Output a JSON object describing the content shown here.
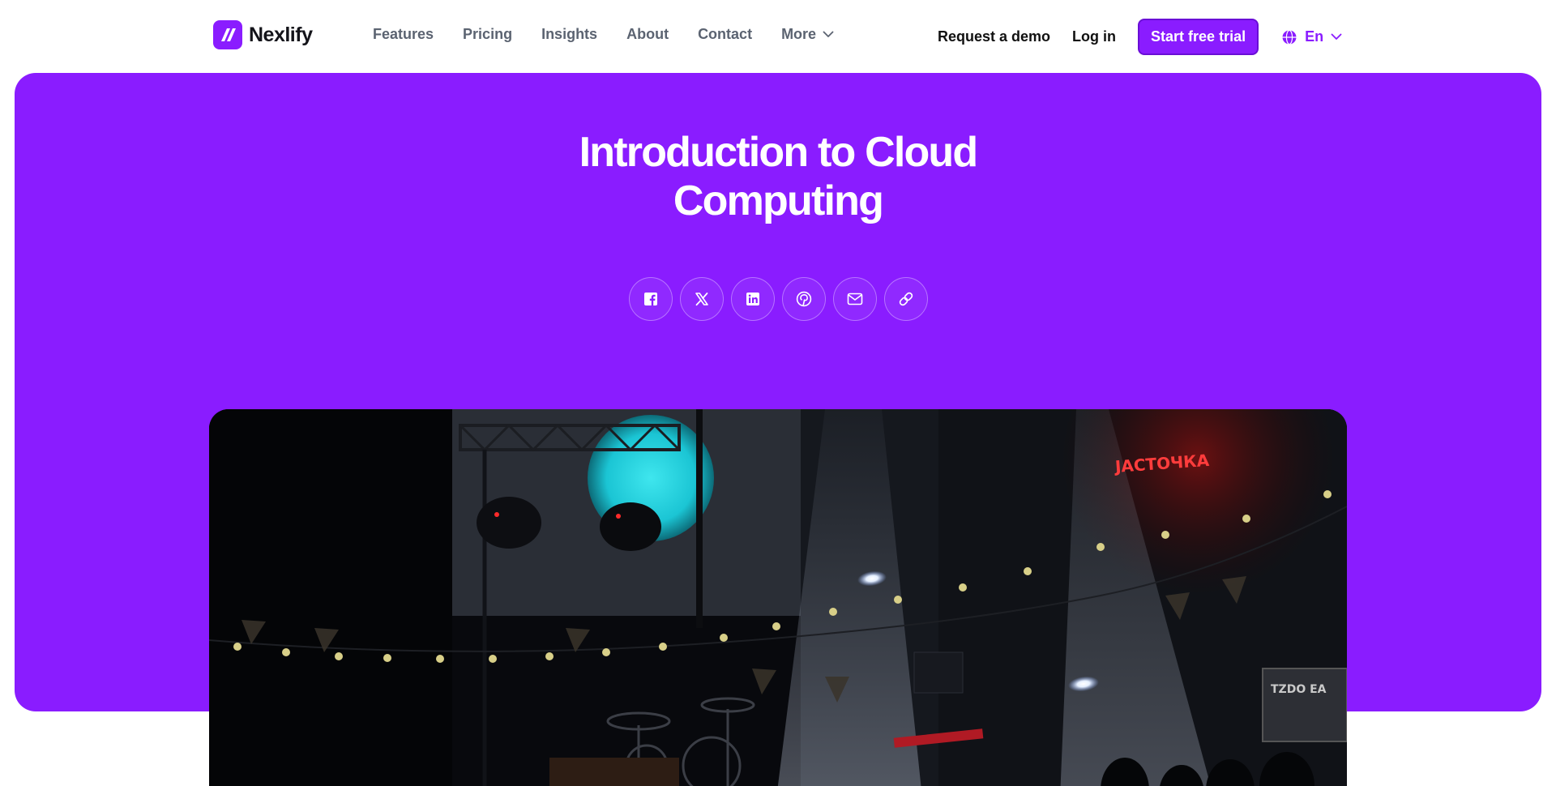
{
  "brand": {
    "name": "Nexlify",
    "color": "#8a1cff"
  },
  "nav": {
    "items": [
      {
        "label": "Features"
      },
      {
        "label": "Pricing"
      },
      {
        "label": "Insights"
      },
      {
        "label": "About"
      },
      {
        "label": "Contact"
      },
      {
        "label": "More",
        "icon": "chevron-down-icon"
      }
    ],
    "request_demo": "Request a demo",
    "login": "Log in",
    "cta": "Start free trial",
    "language": {
      "label": "En",
      "icon": "globe-icon"
    }
  },
  "hero": {
    "title_line1": "Introduction to Cloud",
    "title_line2": "Computing",
    "background": "#8a1cff",
    "share": [
      {
        "icon": "facebook-icon"
      },
      {
        "icon": "x-twitter-icon"
      },
      {
        "icon": "linkedin-icon"
      },
      {
        "icon": "pinterest-icon"
      },
      {
        "icon": "email-icon"
      },
      {
        "icon": "link-icon"
      }
    ]
  },
  "image": {
    "sign_text": "JACTOЧКА",
    "poster_text": "TZDO EA"
  }
}
